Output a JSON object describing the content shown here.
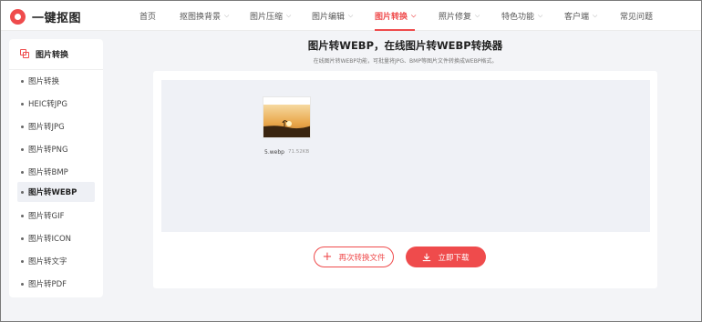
{
  "brand": {
    "name": "一键抠图",
    "accent": "#ef4b4c"
  },
  "nav": {
    "items": [
      {
        "label": "首页",
        "has_dropdown": false
      },
      {
        "label": "抠图换背景",
        "has_dropdown": true
      },
      {
        "label": "图片压缩",
        "has_dropdown": true
      },
      {
        "label": "图片编辑",
        "has_dropdown": true
      },
      {
        "label": "图片转换",
        "has_dropdown": true,
        "active": true
      },
      {
        "label": "照片修复",
        "has_dropdown": true
      },
      {
        "label": "特色功能",
        "has_dropdown": true
      },
      {
        "label": "客户端",
        "has_dropdown": true
      },
      {
        "label": "常见问题",
        "has_dropdown": false
      }
    ]
  },
  "sidebar": {
    "title": "图片转换",
    "items": [
      {
        "label": "图片转换"
      },
      {
        "label": "HEIC转JPG"
      },
      {
        "label": "图片转JPG"
      },
      {
        "label": "图片转PNG"
      },
      {
        "label": "图片转BMP"
      },
      {
        "label": "图片转WEBP",
        "active": true
      },
      {
        "label": "图片转GIF"
      },
      {
        "label": "图片转ICON"
      },
      {
        "label": "图片转文字"
      },
      {
        "label": "图片转PDF"
      }
    ]
  },
  "main": {
    "title": "图片转WEBP，在线图片转WEBP转换器",
    "subtitle": "在线图片转WEBP功能，可批量将JPG、BMP等图片文件转换成WEBP格式。",
    "file": {
      "name": "5.webp",
      "size": "71.52KB"
    },
    "redo_label": "再次转换文件",
    "download_label": "立即下载"
  }
}
